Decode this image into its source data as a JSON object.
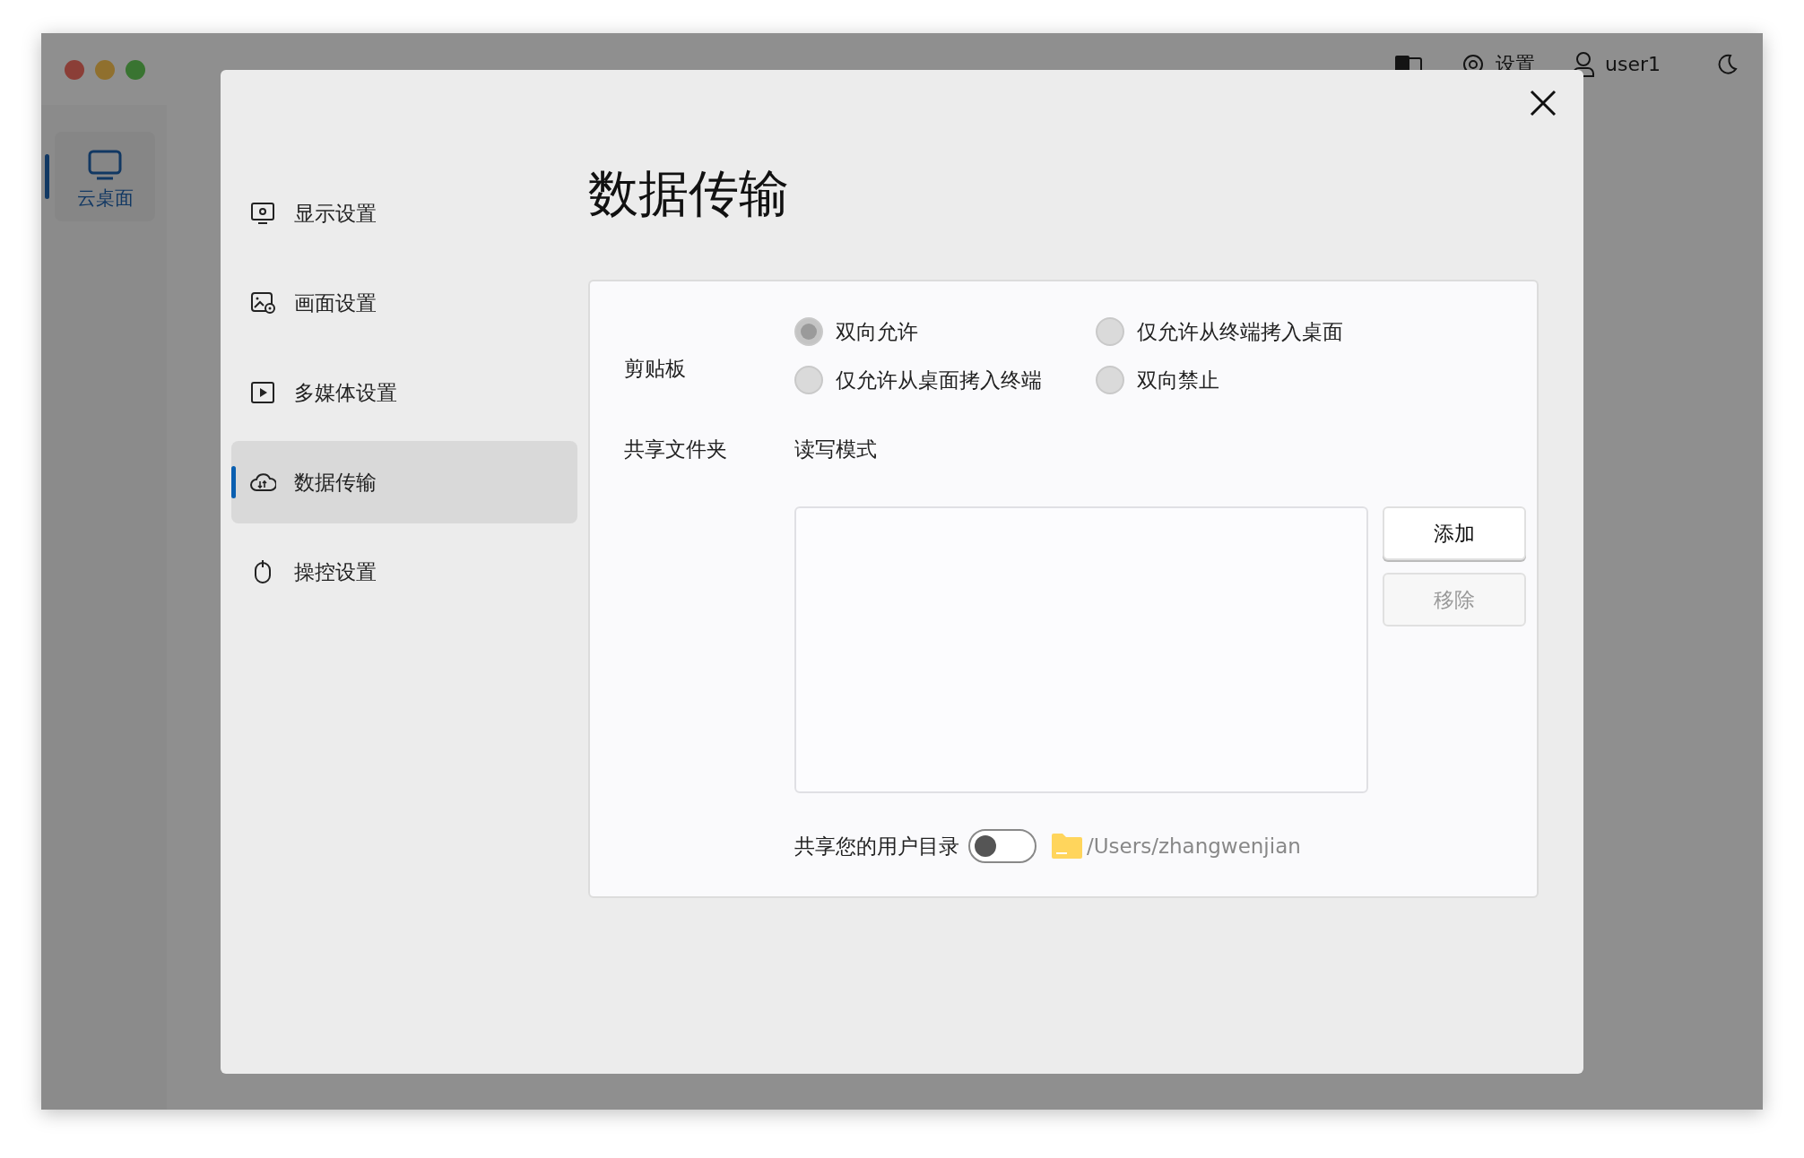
{
  "top_bar": {
    "settings_label": "设置",
    "user": "user1"
  },
  "rail": {
    "items": [
      {
        "label": "云桌面",
        "selected": true
      }
    ]
  },
  "dialog": {
    "menu": [
      {
        "label": "显示设置",
        "selected": false
      },
      {
        "label": "画面设置",
        "selected": false
      },
      {
        "label": "多媒体设置",
        "selected": false
      },
      {
        "label": "数据传输",
        "selected": true
      },
      {
        "label": "操控设置",
        "selected": false
      }
    ],
    "title": "数据传输",
    "clipboard": {
      "label": "剪贴板",
      "options": [
        {
          "label": "双向允许",
          "selected": true
        },
        {
          "label": "仅允许从终端拷入桌面",
          "selected": false
        },
        {
          "label": "仅允许从桌面拷入终端",
          "selected": false
        },
        {
          "label": "双向禁止",
          "selected": false
        }
      ]
    },
    "shared_folder": {
      "label": "共享文件夹",
      "mode": "读写模式",
      "buttons": [
        {
          "label": "添加",
          "disabled": false
        },
        {
          "label": "移除",
          "disabled": true
        }
      ],
      "share_home": {
        "label": "共享您的用户目录",
        "on": false,
        "path": "/Users/zhangwenjian"
      }
    }
  }
}
